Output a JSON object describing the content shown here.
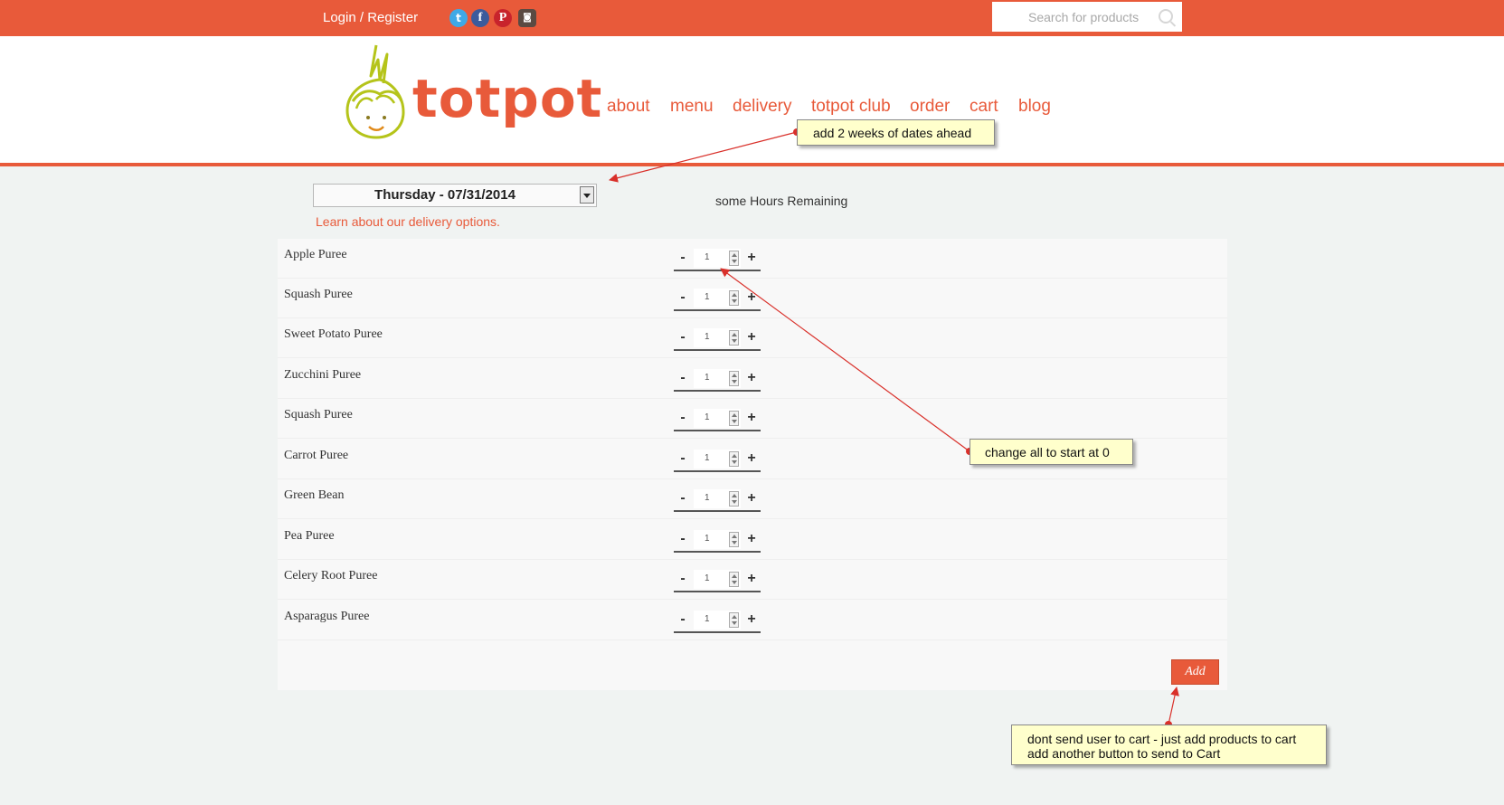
{
  "topbar": {
    "login_label": "Login / Register",
    "social": [
      {
        "icon": "twitter-icon",
        "glyph": "t",
        "color": "#3fa9e6"
      },
      {
        "icon": "facebook-icon",
        "glyph": "f",
        "color": "#3b5b9c"
      },
      {
        "icon": "pinterest-icon",
        "glyph": "P",
        "color": "#c8232c"
      },
      {
        "icon": "instagram-icon",
        "glyph": "◙",
        "color": "#5a4a42"
      }
    ],
    "search_placeholder": "Search for products",
    "search_icon": "search-icon"
  },
  "header": {
    "logo_text": "totpot",
    "nav": [
      "about",
      "menu",
      "delivery",
      "totpot club",
      "order",
      "cart",
      "blog"
    ]
  },
  "order": {
    "date_selected": "Thursday - 07/31/2014",
    "delivery_link": "Learn about our delivery options.",
    "hours_remaining": "some Hours Remaining"
  },
  "products": [
    {
      "name": "Apple Puree",
      "qty": "1"
    },
    {
      "name": "Squash Puree",
      "qty": "1"
    },
    {
      "name": "Sweet Potato Puree",
      "qty": "1"
    },
    {
      "name": "Zucchini Puree",
      "qty": "1"
    },
    {
      "name": "Squash Puree",
      "qty": "1"
    },
    {
      "name": "Carrot Puree",
      "qty": "1"
    },
    {
      "name": "Green Bean",
      "qty": "1"
    },
    {
      "name": "Pea Puree",
      "qty": "1"
    },
    {
      "name": "Celery Root Puree",
      "qty": "1"
    },
    {
      "name": "Asparagus Puree",
      "qty": "1"
    }
  ],
  "stepper": {
    "minus": "-",
    "plus": "+"
  },
  "add_label": "Add",
  "annotations": [
    {
      "lines": [
        "add 2 weeks of dates ahead"
      ]
    },
    {
      "lines": [
        "change all to start at 0"
      ]
    },
    {
      "lines": [
        "dont send user to cart - just add products to cart",
        "add another button to send to Cart"
      ]
    }
  ],
  "colors": {
    "brand": "#e85a3a",
    "note_bg": "#ffffcc",
    "arrow": "#d9302a",
    "logo_green": "#b5c41a"
  }
}
